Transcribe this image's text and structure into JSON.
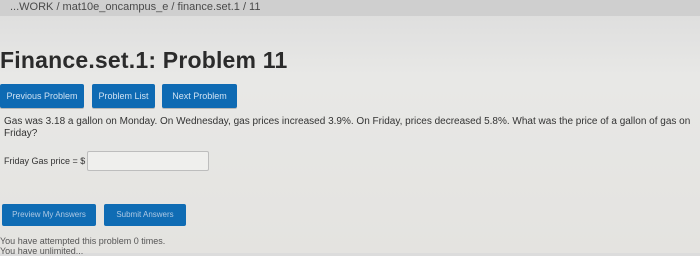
{
  "breadcrumb": "...WORK / mat10e_oncampus_e / finance.set.1 / 11",
  "page_title": "Finance.set.1: Problem 11",
  "nav": {
    "previous": "Previous Problem",
    "list": "Problem List",
    "next": "Next Problem"
  },
  "problem": {
    "text": "Gas was 3.18 a gallon on Monday. On Wednesday, gas prices increased 3.9%. On Friday, prices decreased 5.8%. What was the price of a gallon of gas on Friday?"
  },
  "answer": {
    "label": "Friday Gas price = $",
    "value": ""
  },
  "actions": {
    "preview": "Preview My Answers",
    "submit": "Submit Answers"
  },
  "status": {
    "attempts": "You have attempted this problem 0 times.",
    "unlimited": "You have unlimited..."
  },
  "colors": {
    "button_blue": "#0e6ab3"
  }
}
